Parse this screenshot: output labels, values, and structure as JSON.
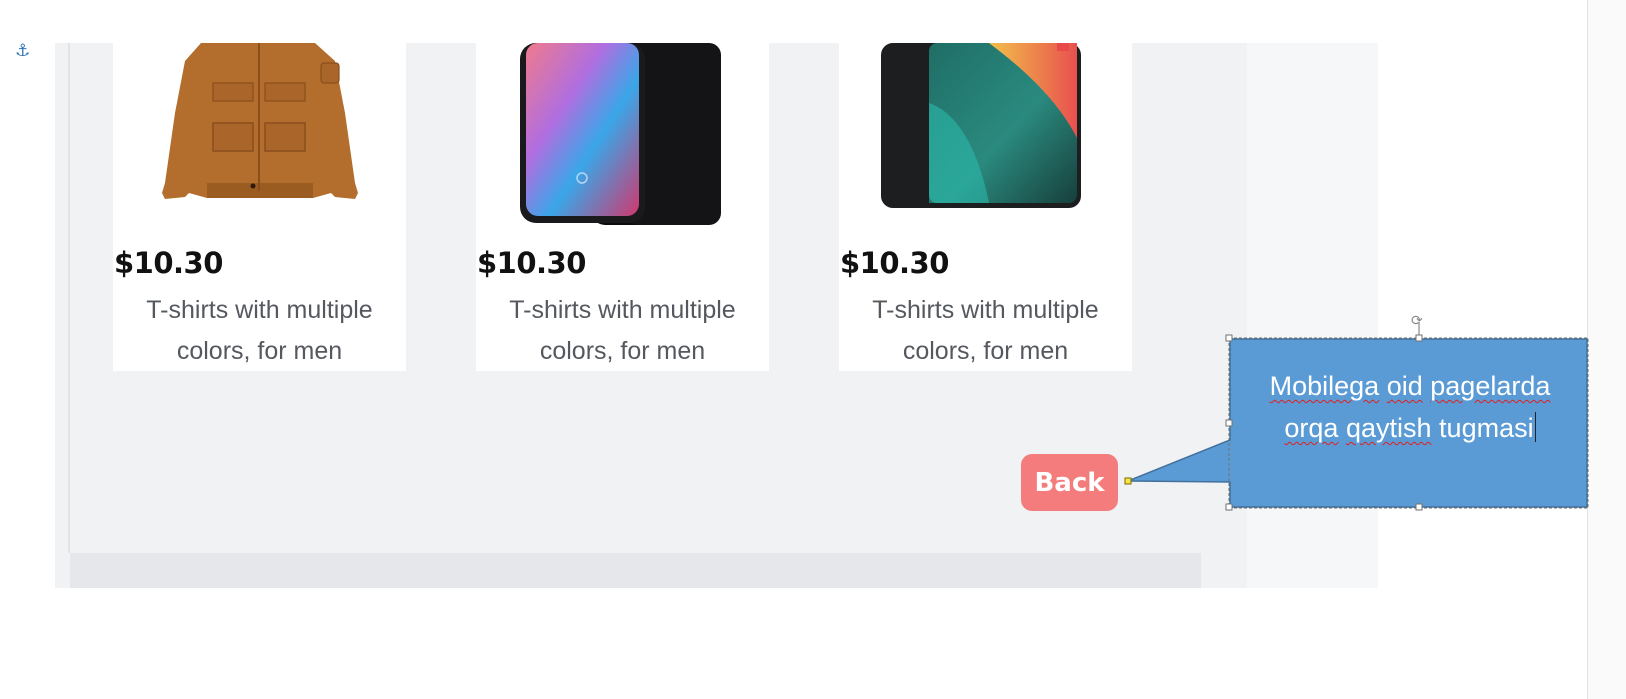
{
  "document": {
    "anchor_icon": "anchor-icon"
  },
  "products": [
    {
      "image": "brown-jacket",
      "price": "$10.30",
      "description": "T-shirts with multiple colors, for men"
    },
    {
      "image": "smartphone",
      "price": "$10.30",
      "description": "T-shirts with multiple colors, for men"
    },
    {
      "image": "tablet",
      "price": "$10.30",
      "description": "T-shirts with multiple colors, for men"
    }
  ],
  "back_button": {
    "label": "Back",
    "color": "#f47c7c"
  },
  "callout": {
    "line1": [
      "Mobilega",
      "oid",
      "pagelarda"
    ],
    "line2": [
      "orqa",
      "qaytish",
      "tugmasi"
    ],
    "fill_color": "#5b9bd5",
    "border_color": "#41719c",
    "spellcheck_flagged": [
      "Mobilega",
      "oid",
      "pagelarda",
      "orqa",
      "qaytish"
    ]
  },
  "colors": {
    "page_background": "#f1f2f4",
    "card_background": "#ffffff",
    "price_text": "#111111",
    "description_text": "#55585e"
  }
}
